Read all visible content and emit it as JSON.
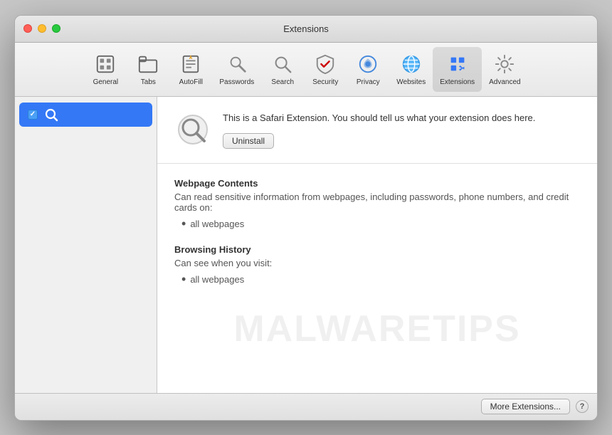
{
  "window": {
    "title": "Extensions"
  },
  "toolbar": {
    "items": [
      {
        "id": "general",
        "label": "General",
        "icon": "general"
      },
      {
        "id": "tabs",
        "label": "Tabs",
        "icon": "tabs"
      },
      {
        "id": "autofill",
        "label": "AutoFill",
        "icon": "autofill"
      },
      {
        "id": "passwords",
        "label": "Passwords",
        "icon": "passwords"
      },
      {
        "id": "search",
        "label": "Search",
        "icon": "search"
      },
      {
        "id": "security",
        "label": "Security",
        "icon": "security"
      },
      {
        "id": "privacy",
        "label": "Privacy",
        "icon": "privacy"
      },
      {
        "id": "websites",
        "label": "Websites",
        "icon": "websites"
      },
      {
        "id": "extensions",
        "label": "Extensions",
        "icon": "extensions"
      },
      {
        "id": "advanced",
        "label": "Advanced",
        "icon": "advanced"
      }
    ]
  },
  "sidebar": {
    "items": [
      {
        "id": "search-ext",
        "label": "",
        "checked": true
      }
    ]
  },
  "detail": {
    "description": "This is a Safari Extension. You should tell us what your extension does here.",
    "uninstall_button": "Uninstall",
    "permissions": [
      {
        "title": "Webpage Contents",
        "description": "Can read sensitive information from webpages, including passwords, phone numbers, and credit cards on:",
        "items": [
          "all webpages"
        ]
      },
      {
        "title": "Browsing History",
        "description": "Can see when you visit:",
        "items": [
          "all webpages"
        ]
      }
    ]
  },
  "footer": {
    "more_extensions_label": "More Extensions...",
    "help_label": "?"
  },
  "watermark": {
    "text": "MALWARETIPS"
  }
}
